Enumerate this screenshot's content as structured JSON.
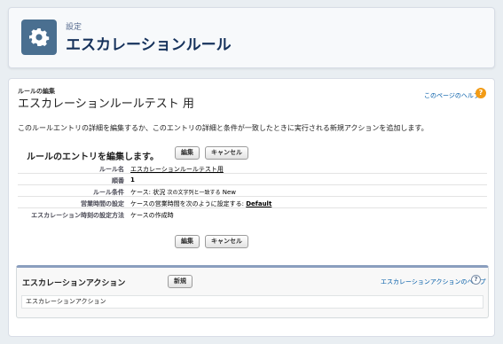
{
  "header": {
    "breadcrumb": "設定",
    "title": "エスカレーションルール",
    "icon": "gear-icon"
  },
  "main": {
    "small_heading": "ルールの編集",
    "rule_title": "エスカレーションルールテスト 用",
    "help_link": "このページのヘルプ",
    "help_icon": "?",
    "description": "このルールエントリの詳細を編集するか、このエントリの詳細と条件が一致したときに実行される新規アクションを追加します。",
    "section_heading": "ルールのエントリを編集します。",
    "buttons": {
      "edit": "編集",
      "cancel": "キャンセル"
    },
    "details": [
      {
        "label": "ルール名",
        "value": "エスカレーションルールテスト用"
      },
      {
        "label": "順番",
        "value": "1"
      },
      {
        "label": "ルール条件",
        "value_prefix": "ケース: 状況",
        "value_mid": "次の文字列と一致する",
        "value_suffix": "New"
      },
      {
        "label": "営業時間の設定",
        "value_prefix": "ケースの営業時間を次のように設定する:",
        "value_link": "Default"
      },
      {
        "label": "エスカレーション時刻の設定方法",
        "value": "ケースの作成時"
      }
    ]
  },
  "escalation": {
    "title": "エスカレーションアクション",
    "new_button": "新規",
    "help_link": "エスカレーションアクションのヘルプ",
    "help_icon": "?",
    "list_header": "エスカレーションアクション"
  },
  "colors": {
    "accent": "#4a6f90",
    "link": "#015ba7",
    "help_orange": "#f29b15",
    "background": "#e9eef2"
  }
}
